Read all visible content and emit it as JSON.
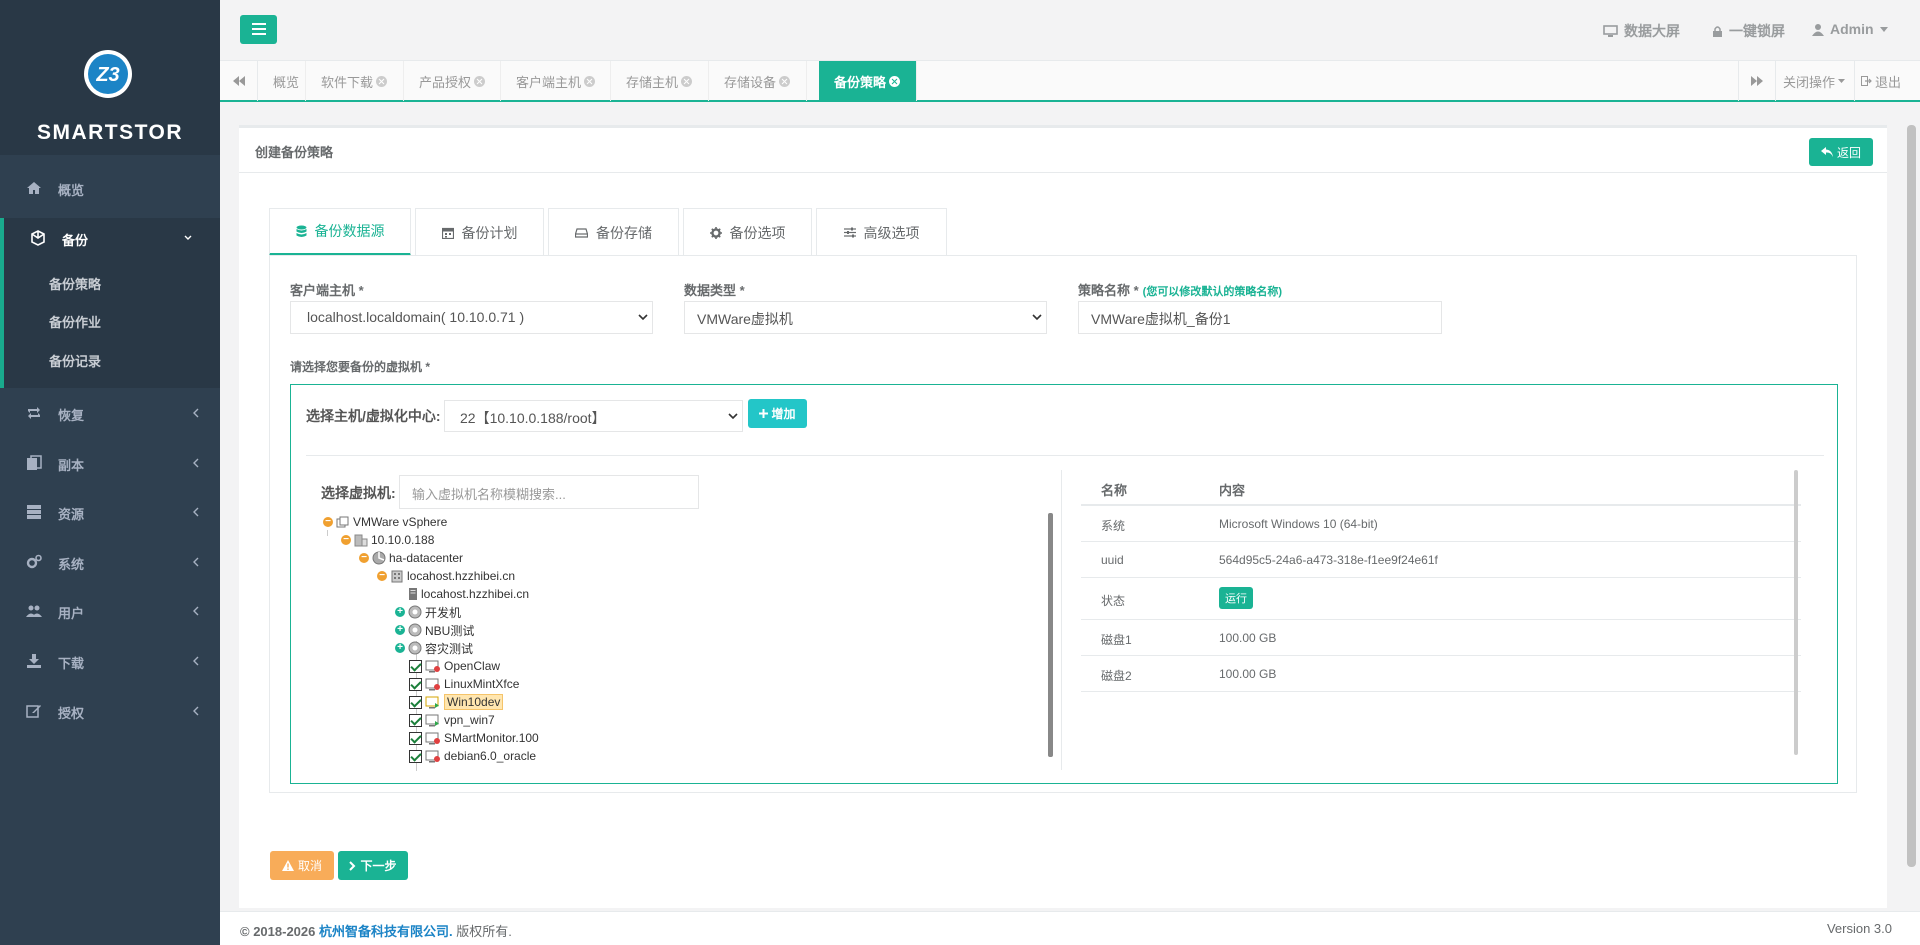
{
  "brand": {
    "name": "SMARTSTOR",
    "logo_text": "Z3"
  },
  "sidebar": {
    "items": [
      {
        "label": "概览",
        "icon": "home-icon"
      },
      {
        "label": "备份",
        "icon": "cube-icon"
      },
      {
        "label": "恢复",
        "icon": "retweet-icon"
      },
      {
        "label": "副本",
        "icon": "copy-icon"
      },
      {
        "label": "资源",
        "icon": "server-icon"
      },
      {
        "label": "系统",
        "icon": "cogs-icon"
      },
      {
        "label": "用户",
        "icon": "users-icon"
      },
      {
        "label": "下载",
        "icon": "download-icon"
      },
      {
        "label": "授权",
        "icon": "edit-icon"
      }
    ],
    "backup_sub": [
      "备份策略",
      "备份作业",
      "备份记录"
    ]
  },
  "topbar": {
    "dashboard": "数据大屏",
    "lock": "一键锁屏",
    "user": "Admin"
  },
  "tabs": [
    {
      "label": "概览",
      "closable": false
    },
    {
      "label": "软件下载",
      "closable": true
    },
    {
      "label": "产品授权",
      "closable": true
    },
    {
      "label": "客户端主机",
      "closable": true
    },
    {
      "label": "存储主机",
      "closable": true
    },
    {
      "label": "存储设备",
      "closable": true
    },
    {
      "label": "备份策略",
      "closable": true,
      "active": true
    }
  ],
  "tabbar": {
    "close_ops": "关闭操作",
    "logout": "退出"
  },
  "panel": {
    "title": "创建备份策略",
    "back": "返回"
  },
  "wizard_tabs": [
    {
      "label": "备份数据源",
      "icon": "database-icon",
      "active": true
    },
    {
      "label": "备份计划",
      "icon": "calendar-icon"
    },
    {
      "label": "备份存储",
      "icon": "hdd-icon"
    },
    {
      "label": "备份选项",
      "icon": "gear-icon"
    },
    {
      "label": "高级选项",
      "icon": "sliders-icon"
    }
  ],
  "form": {
    "client_label": "客户端主机 *",
    "client_value": "localhost.localdomain( 10.10.0.71 )",
    "type_label": "数据类型 *",
    "type_value": "VMWare虚拟机",
    "name_label": "策略名称 *",
    "name_hint": "(您可以修改默认的策略名称)",
    "name_value": "VMWare虚拟机_备份1",
    "vm_select_label": "请选择您要备份的虚拟机 *"
  },
  "vmbox": {
    "host_label": "选择主机/虚拟化中心:",
    "host_value": "22【10.10.0.188/root】",
    "add_button": "增加",
    "vm_label": "选择虚拟机:",
    "search_placeholder": "输入虚拟机名称模糊搜索..."
  },
  "tree": [
    {
      "label": "VMWare vSphere",
      "level": 0,
      "toggle": "minus",
      "icon": "vsphere-icon"
    },
    {
      "label": "10.10.0.188",
      "level": 1,
      "toggle": "minus",
      "icon": "host-icon"
    },
    {
      "label": "ha-datacenter",
      "level": 2,
      "toggle": "minus",
      "icon": "datacenter-icon"
    },
    {
      "label": "locahost.hzzhibei.cn",
      "level": 3,
      "toggle": "minus",
      "icon": "cluster-icon"
    },
    {
      "label": "locahost.hzzhibei.cn",
      "level": 4,
      "toggle": "none",
      "icon": "server-icon"
    },
    {
      "label": "开发机",
      "level": 4,
      "toggle": "plus",
      "icon": "resource-pool-icon"
    },
    {
      "label": "NBU测试",
      "level": 4,
      "toggle": "plus",
      "icon": "resource-pool-icon"
    },
    {
      "label": "容灾测试",
      "level": 4,
      "toggle": "plus",
      "icon": "resource-pool-icon"
    },
    {
      "label": "OpenClaw",
      "level": 5,
      "checked": true,
      "icon": "vm-off-icon"
    },
    {
      "label": "LinuxMintXfce",
      "level": 5,
      "checked": true,
      "icon": "vm-off-icon"
    },
    {
      "label": "Win10dev",
      "level": 5,
      "checked": true,
      "icon": "vm-on-icon",
      "selected": true
    },
    {
      "label": "vpn_win7",
      "level": 5,
      "checked": true,
      "icon": "vm-on-icon"
    },
    {
      "label": "SMartMonitor.100",
      "level": 5,
      "checked": true,
      "icon": "vm-off-icon"
    },
    {
      "label": "debian6.0_oracle",
      "level": 5,
      "checked": true,
      "icon": "vm-off-icon"
    }
  ],
  "details": {
    "head": {
      "k": "名称",
      "v": "内容"
    },
    "rows": [
      {
        "k": "系统",
        "v": "Microsoft Windows 10 (64-bit)"
      },
      {
        "k": "uuid",
        "v": "564d95c5-24a6-a473-318e-f1ee9f24e61f"
      },
      {
        "k": "状态",
        "v": "运行",
        "badge": true
      },
      {
        "k": "磁盘1",
        "v": "100.00 GB"
      },
      {
        "k": "磁盘2",
        "v": "100.00 GB"
      }
    ]
  },
  "actions": {
    "cancel": "取消",
    "next": "下一步"
  },
  "footer": {
    "copyright": "© 2018-2026",
    "company": "杭州智备科技有限公司.",
    "rights": "版权所有.",
    "version": "Version 3.0"
  },
  "colors": {
    "primary": "#1ab394",
    "sidebar": "#2f4050",
    "warning": "#f8ac59",
    "info": "#23c6c8"
  }
}
